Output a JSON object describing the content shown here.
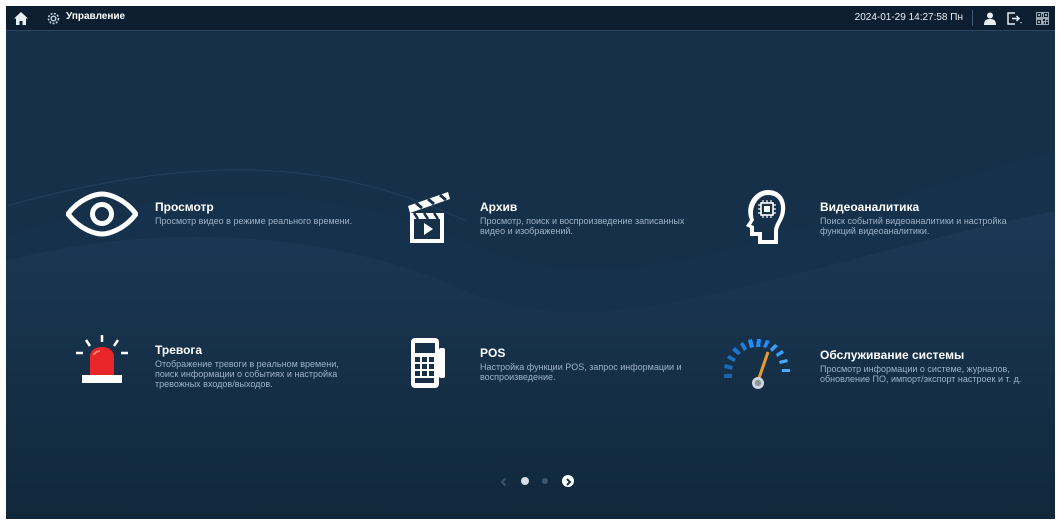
{
  "topbar": {
    "title": "Управление",
    "datetime": "2024-01-29 14:27:58 Пн",
    "icons": [
      "home-icon",
      "settings-gear-icon",
      "user-icon",
      "logout-icon",
      "qr-code-icon"
    ]
  },
  "tiles": [
    {
      "title": "Просмотр",
      "desc": "Просмотр видео в режиме реального времени.",
      "icon": "eye-icon"
    },
    {
      "title": "Архив",
      "desc": "Просмотр, поиск и воспроизведение записанных видео и изображений.",
      "icon": "clapperboard-icon"
    },
    {
      "title": "Видеоаналитика",
      "desc": "Поиск событий видеоаналитики и настройка функций видеоаналитики.",
      "icon": "brain-chip-icon"
    },
    {
      "title": "Тревога",
      "desc": "Отображение тревоги в реальном времени, поиск информации о событиях и настройка тревожных входов/выходов.",
      "icon": "alarm-siren-icon"
    },
    {
      "title": "POS",
      "desc": "Настройка функции POS, запрос информации и воспроизведение.",
      "icon": "pos-terminal-icon"
    },
    {
      "title": "Обслуживание системы",
      "desc": "Просмотр информации о системе, журналов, обновление ПО, импорт/экспорт настроек и т. д.",
      "icon": "gauge-icon"
    }
  ],
  "pager": {
    "pages": 2,
    "current": 1
  },
  "colors": {
    "background": "#173049",
    "topbar": "#0d1e30",
    "accent_red": "#e8262a",
    "gauge_blue": "#1f8fff",
    "text_secondary": "#9db3c8"
  }
}
